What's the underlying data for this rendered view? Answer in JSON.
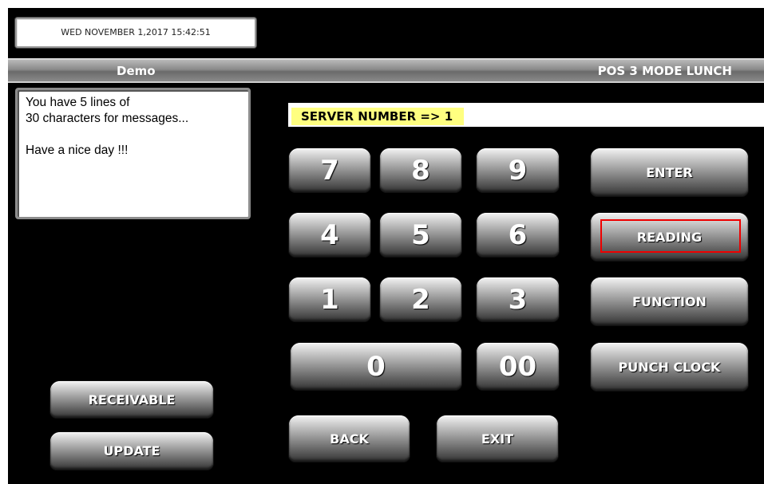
{
  "header": {
    "datetime": "WED NOVEMBER 1,2017 15:42:51"
  },
  "title_bar": {
    "left": "Demo",
    "right": "POS 3  MODE LUNCH"
  },
  "message_box": {
    "lines": [
      "You have 5 lines of",
      "30 characters for messages...",
      "",
      "Have a nice day !!!"
    ]
  },
  "input": {
    "label": "SERVER NUMBER  =>  1"
  },
  "keypad": {
    "k7": "7",
    "k8": "8",
    "k9": "9",
    "k4": "4",
    "k5": "5",
    "k6": "6",
    "k1": "1",
    "k2": "2",
    "k3": "3",
    "k0": "0",
    "k00": "00"
  },
  "actions": {
    "enter": "ENTER",
    "reading": "READING",
    "function": "FUNCTION",
    "punch_clock": "PUNCH CLOCK",
    "back": "BACK",
    "exit": "EXIT",
    "receivable": "RECEIVABLE",
    "update": "UPDATE"
  },
  "colors": {
    "input_highlight": "#ffff80",
    "focus_outline": "#ee0000"
  }
}
